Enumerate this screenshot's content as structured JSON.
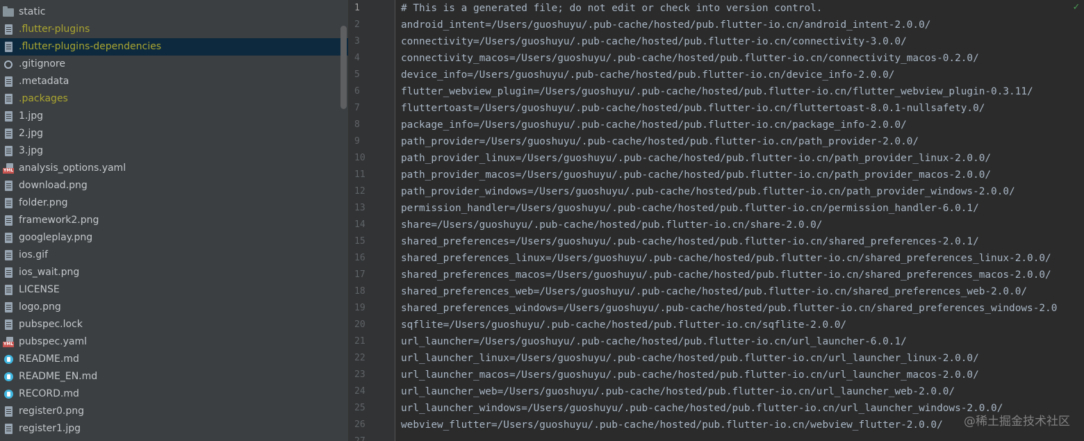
{
  "sidebar": {
    "items": [
      {
        "label": "static",
        "icon": "folder-icon",
        "status": "normal"
      },
      {
        "label": ".flutter-plugins",
        "icon": "file-icon",
        "status": "ignored"
      },
      {
        "label": ".flutter-plugins-dependencies",
        "icon": "file-icon",
        "status": "ignored",
        "selected": true
      },
      {
        "label": ".gitignore",
        "icon": "gitignore-icon",
        "status": "normal"
      },
      {
        "label": ".metadata",
        "icon": "file-icon",
        "status": "normal"
      },
      {
        "label": ".packages",
        "icon": "file-icon",
        "status": "ignored"
      },
      {
        "label": "1.jpg",
        "icon": "file-icon",
        "status": "normal"
      },
      {
        "label": "2.jpg",
        "icon": "file-icon",
        "status": "normal"
      },
      {
        "label": "3.jpg",
        "icon": "file-icon",
        "status": "normal"
      },
      {
        "label": "analysis_options.yaml",
        "icon": "yaml-icon",
        "status": "normal"
      },
      {
        "label": "download.png",
        "icon": "file-icon",
        "status": "normal"
      },
      {
        "label": "folder.png",
        "icon": "file-icon",
        "status": "normal"
      },
      {
        "label": "framework2.png",
        "icon": "file-icon",
        "status": "normal"
      },
      {
        "label": "googleplay.png",
        "icon": "file-icon",
        "status": "normal"
      },
      {
        "label": "ios.gif",
        "icon": "file-icon",
        "status": "normal"
      },
      {
        "label": "ios_wait.png",
        "icon": "file-icon",
        "status": "normal"
      },
      {
        "label": "LICENSE",
        "icon": "file-icon",
        "status": "normal"
      },
      {
        "label": "logo.png",
        "icon": "file-icon",
        "status": "normal"
      },
      {
        "label": "pubspec.lock",
        "icon": "file-icon",
        "status": "normal"
      },
      {
        "label": "pubspec.yaml",
        "icon": "yaml-icon",
        "status": "normal"
      },
      {
        "label": "README.md",
        "icon": "markdown-icon",
        "status": "normal"
      },
      {
        "label": "README_EN.md",
        "icon": "markdown-icon",
        "status": "normal"
      },
      {
        "label": "RECORD.md",
        "icon": "markdown-icon",
        "status": "normal"
      },
      {
        "label": "register0.png",
        "icon": "file-icon",
        "status": "normal"
      },
      {
        "label": "register1.jpg",
        "icon": "file-icon",
        "status": "normal"
      }
    ],
    "yaml_tag": "YML"
  },
  "editor": {
    "lines": [
      "# This is a generated file; do not edit or check into version control.",
      "android_intent=/Users/guoshuyu/.pub-cache/hosted/pub.flutter-io.cn/android_intent-2.0.0/",
      "connectivity=/Users/guoshuyu/.pub-cache/hosted/pub.flutter-io.cn/connectivity-3.0.0/",
      "connectivity_macos=/Users/guoshuyu/.pub-cache/hosted/pub.flutter-io.cn/connectivity_macos-0.2.0/",
      "device_info=/Users/guoshuyu/.pub-cache/hosted/pub.flutter-io.cn/device_info-2.0.0/",
      "flutter_webview_plugin=/Users/guoshuyu/.pub-cache/hosted/pub.flutter-io.cn/flutter_webview_plugin-0.3.11/",
      "fluttertoast=/Users/guoshuyu/.pub-cache/hosted/pub.flutter-io.cn/fluttertoast-8.0.1-nullsafety.0/",
      "package_info=/Users/guoshuyu/.pub-cache/hosted/pub.flutter-io.cn/package_info-2.0.0/",
      "path_provider=/Users/guoshuyu/.pub-cache/hosted/pub.flutter-io.cn/path_provider-2.0.0/",
      "path_provider_linux=/Users/guoshuyu/.pub-cache/hosted/pub.flutter-io.cn/path_provider_linux-2.0.0/",
      "path_provider_macos=/Users/guoshuyu/.pub-cache/hosted/pub.flutter-io.cn/path_provider_macos-2.0.0/",
      "path_provider_windows=/Users/guoshuyu/.pub-cache/hosted/pub.flutter-io.cn/path_provider_windows-2.0.0/",
      "permission_handler=/Users/guoshuyu/.pub-cache/hosted/pub.flutter-io.cn/permission_handler-6.0.1/",
      "share=/Users/guoshuyu/.pub-cache/hosted/pub.flutter-io.cn/share-2.0.0/",
      "shared_preferences=/Users/guoshuyu/.pub-cache/hosted/pub.flutter-io.cn/shared_preferences-2.0.1/",
      "shared_preferences_linux=/Users/guoshuyu/.pub-cache/hosted/pub.flutter-io.cn/shared_preferences_linux-2.0.0/",
      "shared_preferences_macos=/Users/guoshuyu/.pub-cache/hosted/pub.flutter-io.cn/shared_preferences_macos-2.0.0/",
      "shared_preferences_web=/Users/guoshuyu/.pub-cache/hosted/pub.flutter-io.cn/shared_preferences_web-2.0.0/",
      "shared_preferences_windows=/Users/guoshuyu/.pub-cache/hosted/pub.flutter-io.cn/shared_preferences_windows-2.0",
      "sqflite=/Users/guoshuyu/.pub-cache/hosted/pub.flutter-io.cn/sqflite-2.0.0/",
      "url_launcher=/Users/guoshuyu/.pub-cache/hosted/pub.flutter-io.cn/url_launcher-6.0.1/",
      "url_launcher_linux=/Users/guoshuyu/.pub-cache/hosted/pub.flutter-io.cn/url_launcher_linux-2.0.0/",
      "url_launcher_macos=/Users/guoshuyu/.pub-cache/hosted/pub.flutter-io.cn/url_launcher_macos-2.0.0/",
      "url_launcher_web=/Users/guoshuyu/.pub-cache/hosted/pub.flutter-io.cn/url_launcher_web-2.0.0/",
      "url_launcher_windows=/Users/guoshuyu/.pub-cache/hosted/pub.flutter-io.cn/url_launcher_windows-2.0.0/",
      "webview_flutter=/Users/guoshuyu/.pub-cache/hosted/pub.flutter-io.cn/webview_flutter-2.0.0/",
      ""
    ],
    "line_numbers": [
      "1",
      "2",
      "3",
      "4",
      "5",
      "6",
      "7",
      "8",
      "9",
      "10",
      "11",
      "12",
      "13",
      "14",
      "15",
      "16",
      "17",
      "18",
      "19",
      "20",
      "21",
      "22",
      "23",
      "24",
      "25",
      "26",
      "27"
    ],
    "current_line": "1",
    "inspection_icon": "check-icon",
    "inspection_glyph": "✓"
  },
  "watermark": "@稀土掘金技术社区",
  "colors": {
    "sidebar_bg": "#3c3f41",
    "editor_bg": "#2b2b2b",
    "gutter_bg": "#313335",
    "selected_row": "#0d293e",
    "ignored_text": "#a9a531",
    "code_text": "#a9b7c6",
    "line_number": "#606366"
  }
}
